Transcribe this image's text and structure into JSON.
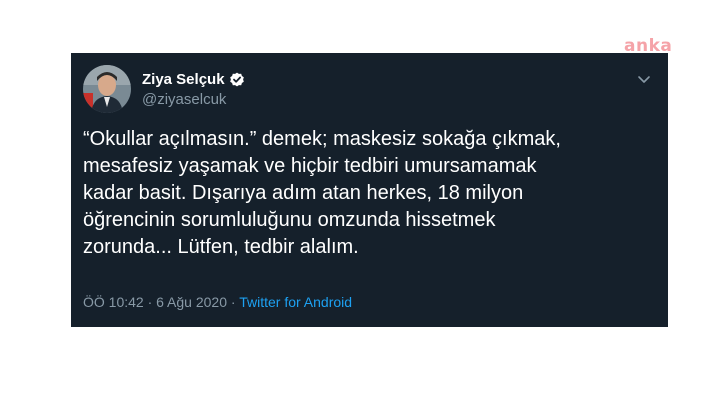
{
  "watermark": {
    "text": "anka"
  },
  "tweet": {
    "author": {
      "display_name": "Ziya Selçuk",
      "handle": "@ziyaselcuk",
      "verified": true
    },
    "text_lines": [
      "“Okullar açılmasın.” demek; maskesiz sokağa çıkmak,",
      "mesafesiz yaşamak ve hiçbir tedbiri umursamamak",
      "kadar basit. Dışarıya adım atan herkes, 18 milyon",
      "öğrencinin sorumluluğunu omzunda hissetmek",
      "zorunda... Lütfen, tedbir alalım."
    ],
    "meta": {
      "time": "ÖÖ 10:42",
      "separator": " · ",
      "date": "6 Ağu 2020",
      "separator2": " · ",
      "source": "Twitter for Android"
    }
  },
  "icons": {
    "verified": "verified-badge-icon",
    "menu": "chevron-down-icon"
  },
  "colors": {
    "card_background": "#15202b",
    "text_primary": "#ffffff",
    "text_secondary": "#8899a6",
    "link": "#1da1f2",
    "watermark": "#f5a3a8"
  }
}
